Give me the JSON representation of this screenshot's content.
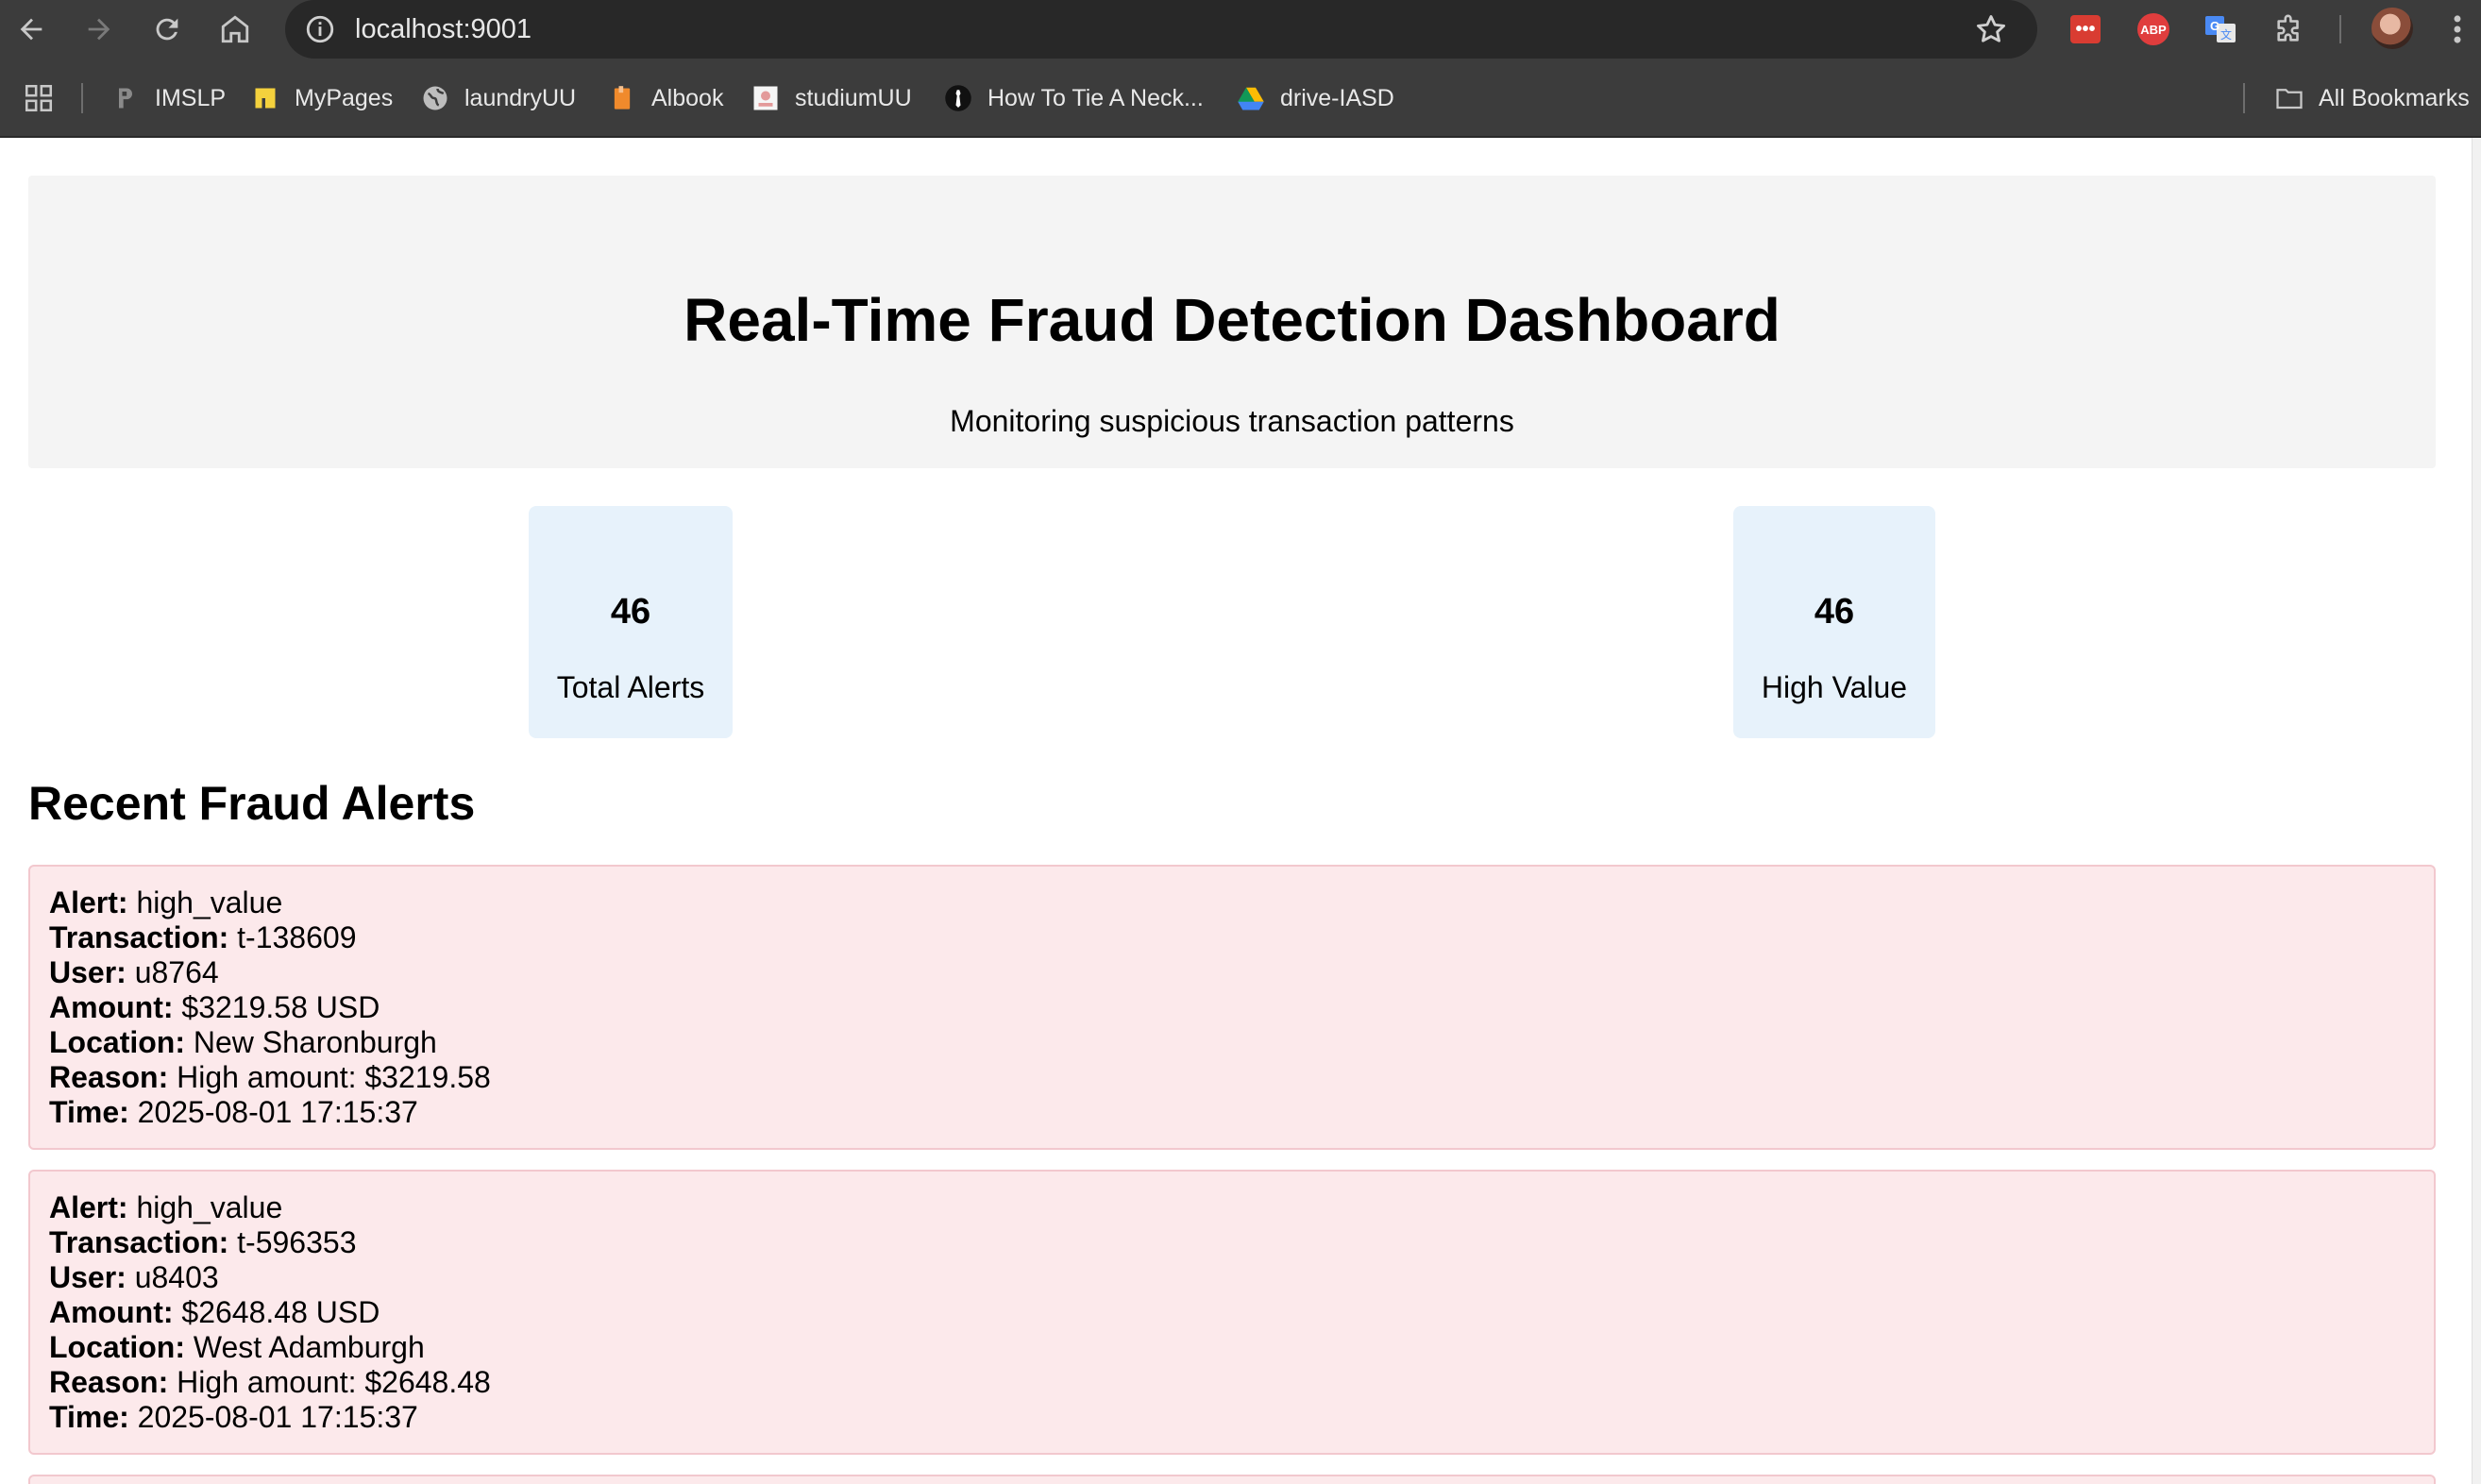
{
  "browser": {
    "url": "localhost:9001",
    "bookmarks": [
      {
        "label": "IMSLP",
        "icon": "imslp-icon"
      },
      {
        "label": "MyPages",
        "icon": "mypages-icon"
      },
      {
        "label": "laundryUU",
        "icon": "globe-icon"
      },
      {
        "label": "Albook",
        "icon": "book-icon"
      },
      {
        "label": "studiumUU",
        "icon": "studium-icon"
      },
      {
        "label": "How To Tie A Neck...",
        "icon": "tie-icon"
      },
      {
        "label": "drive-IASD",
        "icon": "google-drive-icon"
      }
    ],
    "all_bookmarks_label": "All Bookmarks",
    "extension_red_label": "•••",
    "extension_abp_label": "ABP"
  },
  "header": {
    "title": "Real-Time Fraud Detection Dashboard",
    "subtitle": "Monitoring suspicious transaction patterns"
  },
  "stats": [
    {
      "value": "46",
      "label": "Total Alerts"
    },
    {
      "value": "46",
      "label": "High Value"
    }
  ],
  "alerts_section": {
    "title": "Recent Fraud Alerts",
    "field_labels": {
      "alert": "Alert:",
      "transaction": "Transaction:",
      "user": "User:",
      "amount": "Amount:",
      "location": "Location:",
      "reason": "Reason:",
      "time": "Time:"
    },
    "alerts": [
      {
        "alert": "high_value",
        "transaction": "t-138609",
        "user": "u8764",
        "amount": "$3219.58 USD",
        "location": "New Sharonburgh",
        "reason": "High amount: $3219.58",
        "time": "2025-08-01 17:15:37"
      },
      {
        "alert": "high_value",
        "transaction": "t-596353",
        "user": "u8403",
        "amount": "$2648.48 USD",
        "location": "West Adamburgh",
        "reason": "High amount: $2648.48",
        "time": "2025-08-01 17:15:37"
      }
    ]
  }
}
